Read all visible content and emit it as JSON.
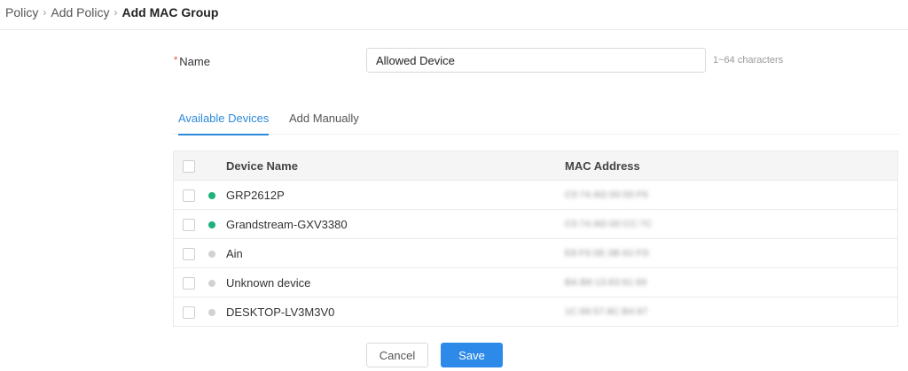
{
  "breadcrumb": {
    "items": [
      "Policy",
      "Add Policy"
    ],
    "separator": "›",
    "current": "Add MAC Group"
  },
  "form": {
    "name_required_mark": "*",
    "name_label": "Name",
    "name_value": "Allowed Device",
    "name_hint": "1~64 characters"
  },
  "tabs": [
    {
      "label": "Available Devices",
      "active": true
    },
    {
      "label": "Add Manually",
      "active": false
    }
  ],
  "table": {
    "columns": [
      "Device Name",
      "MAC Address"
    ],
    "rows": [
      {
        "name": "GRP2612P",
        "status": "online",
        "mac": "C0:74:AD:00:00:F6"
      },
      {
        "name": "Grandstream-GXV3380",
        "status": "online",
        "mac": "C0:74:AD:00:CC:7C"
      },
      {
        "name": "Ain",
        "status": "offline",
        "mac": "E8:F6:0E:3B:62:FD"
      },
      {
        "name": "Unknown device",
        "status": "offline",
        "mac": "BA:B8:13:83:91:69"
      },
      {
        "name": "DESKTOP-LV3M3V0",
        "status": "offline",
        "mac": "1C:99:57:8C:B4:97"
      }
    ]
  },
  "buttons": {
    "cancel": "Cancel",
    "save": "Save"
  },
  "colors": {
    "accent": "#2d8ad8",
    "online": "#1cb27a",
    "offline": "#d2d2d2",
    "required": "#e8453c"
  }
}
